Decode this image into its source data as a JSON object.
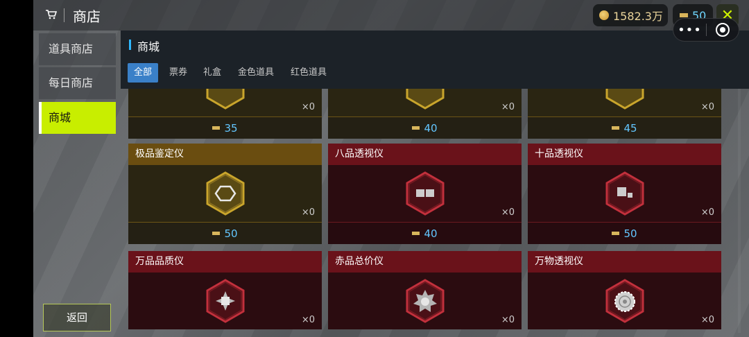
{
  "header": {
    "title": "商店",
    "gold_amount": "1582.3万",
    "ticket_amount": "50",
    "close_symbol": "✕",
    "capsule_more": "•••"
  },
  "sidebar": {
    "items": [
      {
        "label": "道具商店"
      },
      {
        "label": "每日商店"
      },
      {
        "label": "商城"
      }
    ],
    "back_label": "返回"
  },
  "shop": {
    "section_title": "商城",
    "filters": [
      "全部",
      "票券",
      "礼盒",
      "金色道具",
      "红色道具"
    ],
    "active_filter": "全部"
  },
  "items": {
    "row0": [
      {
        "qty": "×0",
        "price": "35",
        "tier": "gold"
      },
      {
        "qty": "×0",
        "price": "40",
        "tier": "gold"
      },
      {
        "qty": "×0",
        "price": "45",
        "tier": "gold"
      }
    ],
    "row1": [
      {
        "name": "极品鉴定仪",
        "qty": "×0",
        "price": "50",
        "tier": "gold",
        "icon": "hexagon-icon"
      },
      {
        "name": "八品透视仪",
        "qty": "×0",
        "price": "40",
        "tier": "red",
        "icon": "two-squares-icon"
      },
      {
        "name": "十品透视仪",
        "qty": "×0",
        "price": "50",
        "tier": "red",
        "icon": "square-dot-icon"
      }
    ],
    "row2": [
      {
        "name": "万品品质仪",
        "qty": "×0",
        "tier": "red",
        "icon": "diamond-star-icon"
      },
      {
        "name": "赤品总价仪",
        "qty": "×0",
        "tier": "red",
        "icon": "star-gear-icon"
      },
      {
        "name": "万物透视仪",
        "qty": "×0",
        "tier": "red",
        "icon": "rosette-icon"
      }
    ]
  },
  "colors": {
    "accent_lime": "#c8ee00",
    "accent_blue": "#3a80c8",
    "price_blue": "#63c6ff"
  }
}
